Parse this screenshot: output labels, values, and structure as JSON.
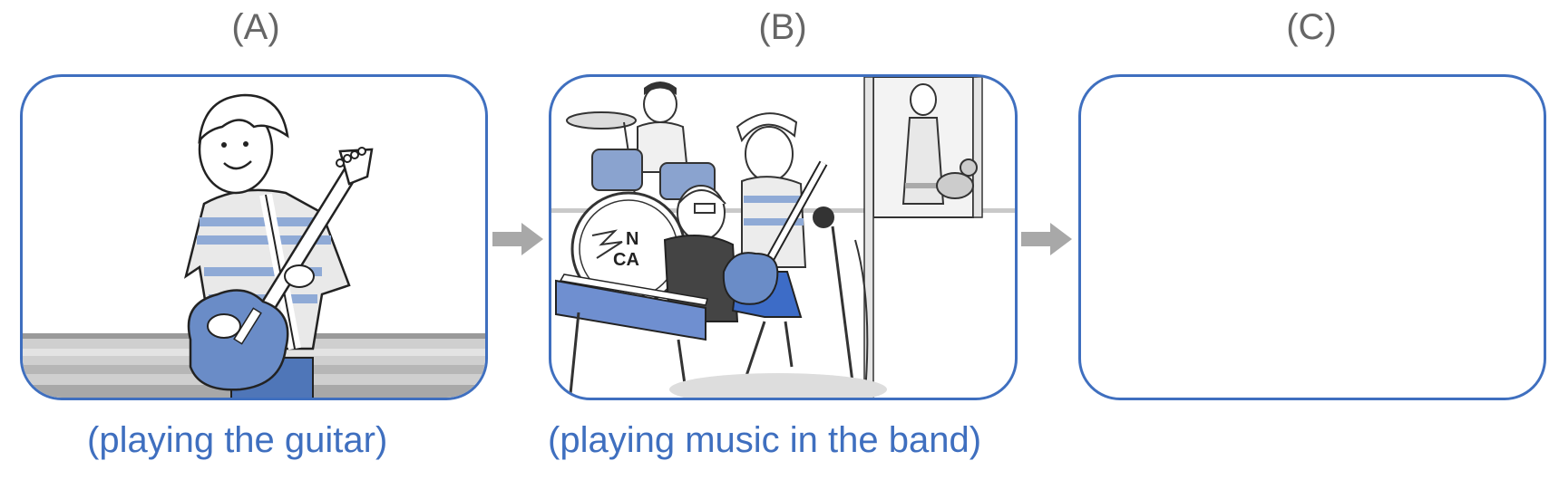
{
  "panels": [
    {
      "letter": "(A)",
      "caption": "(playing the guitar)",
      "illustration": "boy-playing-guitar"
    },
    {
      "letter": "(B)",
      "caption": "(playing music in the band)",
      "illustration": "band-playing-with-woman-covering-ears",
      "drum_text": "N\nCA"
    },
    {
      "letter": "(C)",
      "caption": "",
      "illustration": "empty"
    }
  ],
  "arrows": [
    "arrow-right-icon",
    "arrow-right-icon"
  ],
  "colors": {
    "accent": "#3f6fbf",
    "letter": "#666666",
    "arrow": "#a8a8a8"
  }
}
